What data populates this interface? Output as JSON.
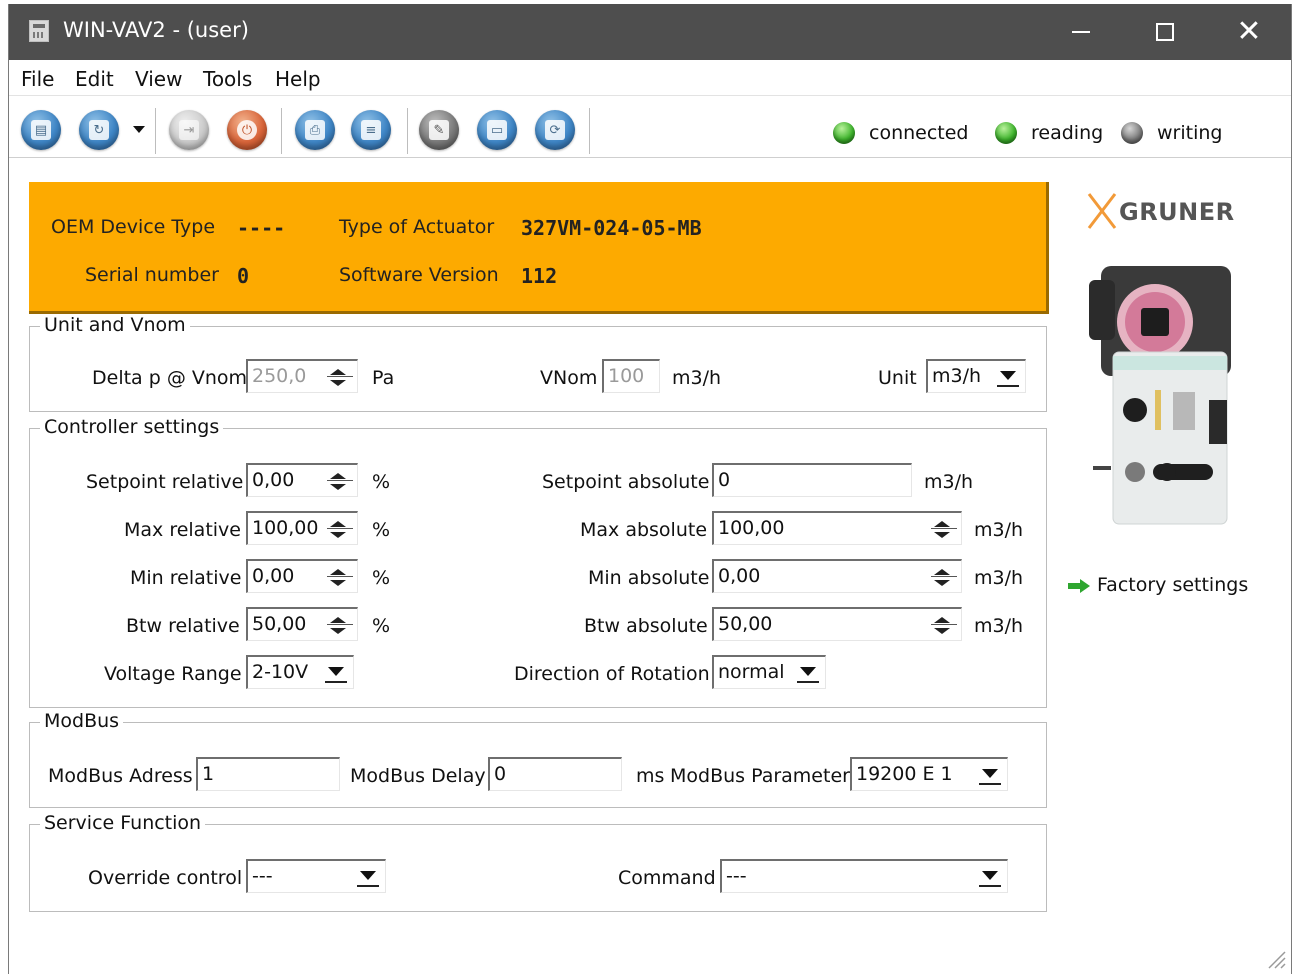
{
  "window": {
    "title": "WIN-VAV2 - (user)"
  },
  "menu": {
    "items": [
      "File",
      "Edit",
      "View",
      "Tools",
      "Help"
    ]
  },
  "toolbar": {
    "buttons": [
      {
        "icon": "database-icon",
        "color": "#3f86c6"
      },
      {
        "icon": "read-device-icon",
        "color": "#3f86c6"
      },
      {
        "icon": "disconnect-icon",
        "color": "#c8c8c8"
      },
      {
        "icon": "power-icon",
        "color": "#d9653a"
      },
      {
        "icon": "print-icon",
        "color": "#3f86c6"
      },
      {
        "icon": "document-icon",
        "color": "#3f86c6"
      },
      {
        "icon": "edit-icon",
        "color": "#7a7a7a"
      },
      {
        "icon": "folder-open-icon",
        "color": "#3f86c6"
      },
      {
        "icon": "refresh-icon",
        "color": "#3f86c6"
      }
    ],
    "status": [
      {
        "label": "connected",
        "state": "on",
        "color": "#3fb52d"
      },
      {
        "label": "reading",
        "state": "on",
        "color": "#3fb52d"
      },
      {
        "label": "writing",
        "state": "off",
        "color": "#7d7d7d"
      }
    ]
  },
  "device": {
    "oem_label": "OEM Device Type",
    "oem_value": "----",
    "actuator_label": "Type of Actuator",
    "actuator_value": "327VM-024-05-MB",
    "serial_label": "Serial number",
    "serial_value": "0",
    "software_label": "Software Version",
    "software_value": "112",
    "banner_color": "#fdaa00"
  },
  "unit_vnom": {
    "legend": "Unit and Vnom",
    "delta_label": "Delta p @ Vnom",
    "delta_value": "250,0",
    "delta_unit": "Pa",
    "vnom_label": "VNom",
    "vnom_value": "100",
    "vnom_unit": "m3/h",
    "unit_label": "Unit",
    "unit_value": "m3/h"
  },
  "controller": {
    "legend": "Controller settings",
    "setpoint_rel_label": "Setpoint relative",
    "setpoint_rel_value": "0,00",
    "max_rel_label": "Max relative",
    "max_rel_value": "100,00",
    "min_rel_label": "Min relative",
    "min_rel_value": "0,00",
    "btw_rel_label": "Btw relative",
    "btw_rel_value": "50,00",
    "percent": "%",
    "voltage_label": "Voltage Range",
    "voltage_value": "2-10V",
    "setpoint_abs_label": "Setpoint absolute",
    "setpoint_abs_value": "0",
    "max_abs_label": "Max absolute",
    "max_abs_value": "100,00",
    "min_abs_label": "Min absolute",
    "min_abs_value": "0,00",
    "btw_abs_label": "Btw absolute",
    "btw_abs_value": "50,00",
    "abs_unit": "m3/h",
    "rotation_label": "Direction of Rotation",
    "rotation_value": "normal"
  },
  "modbus": {
    "legend": "ModBus",
    "address_label": "ModBus Adress",
    "address_value": "1",
    "delay_label": "ModBus Delay",
    "delay_value": "0",
    "delay_unit": "ms",
    "param_label": "ModBus Parameter",
    "param_value": "19200 E 1"
  },
  "service": {
    "legend": "Service Function",
    "override_label": "Override control",
    "override_value": "---",
    "command_label": "Command",
    "command_value": "---"
  },
  "sidebar": {
    "logo_text": "GRUNER",
    "factory_label": "Factory settings"
  }
}
